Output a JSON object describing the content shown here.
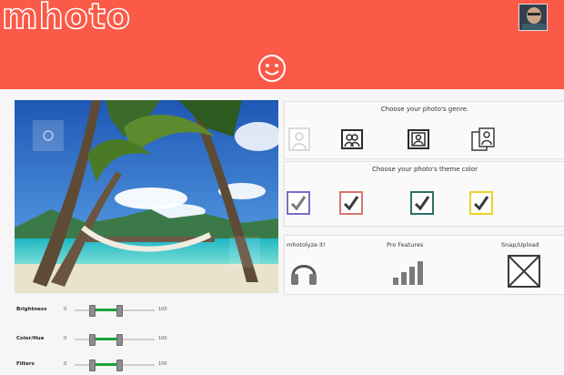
{
  "app": {
    "logo": "mhoto"
  },
  "genre": {
    "title": "Choose your photo's genre.",
    "icons": [
      "single-person-icon",
      "group-portrait-icon",
      "portrait-frame-icon",
      "couple-icon"
    ]
  },
  "theme": {
    "title": "Choose your photo's theme color",
    "swatches": [
      {
        "name": "purple",
        "color": "#7b6cc7"
      },
      {
        "name": "red",
        "color": "#d9746e"
      },
      {
        "name": "teal",
        "color": "#2f6f67"
      },
      {
        "name": "yellow",
        "color": "#ecd22a"
      }
    ]
  },
  "actions": {
    "analyze_label": "mhotolyze it!",
    "pro_label": "Pro Features",
    "snap_label": "Snap/Upload"
  },
  "sliders": [
    {
      "label": "Brightness",
      "min": "0",
      "max": "100"
    },
    {
      "label": "Color/Hue",
      "min": "0",
      "max": "100"
    },
    {
      "label": "Filters",
      "min": "0",
      "max": "100"
    }
  ],
  "colors": {
    "header": "#fb5a48",
    "accent_green": "#19a33a"
  }
}
